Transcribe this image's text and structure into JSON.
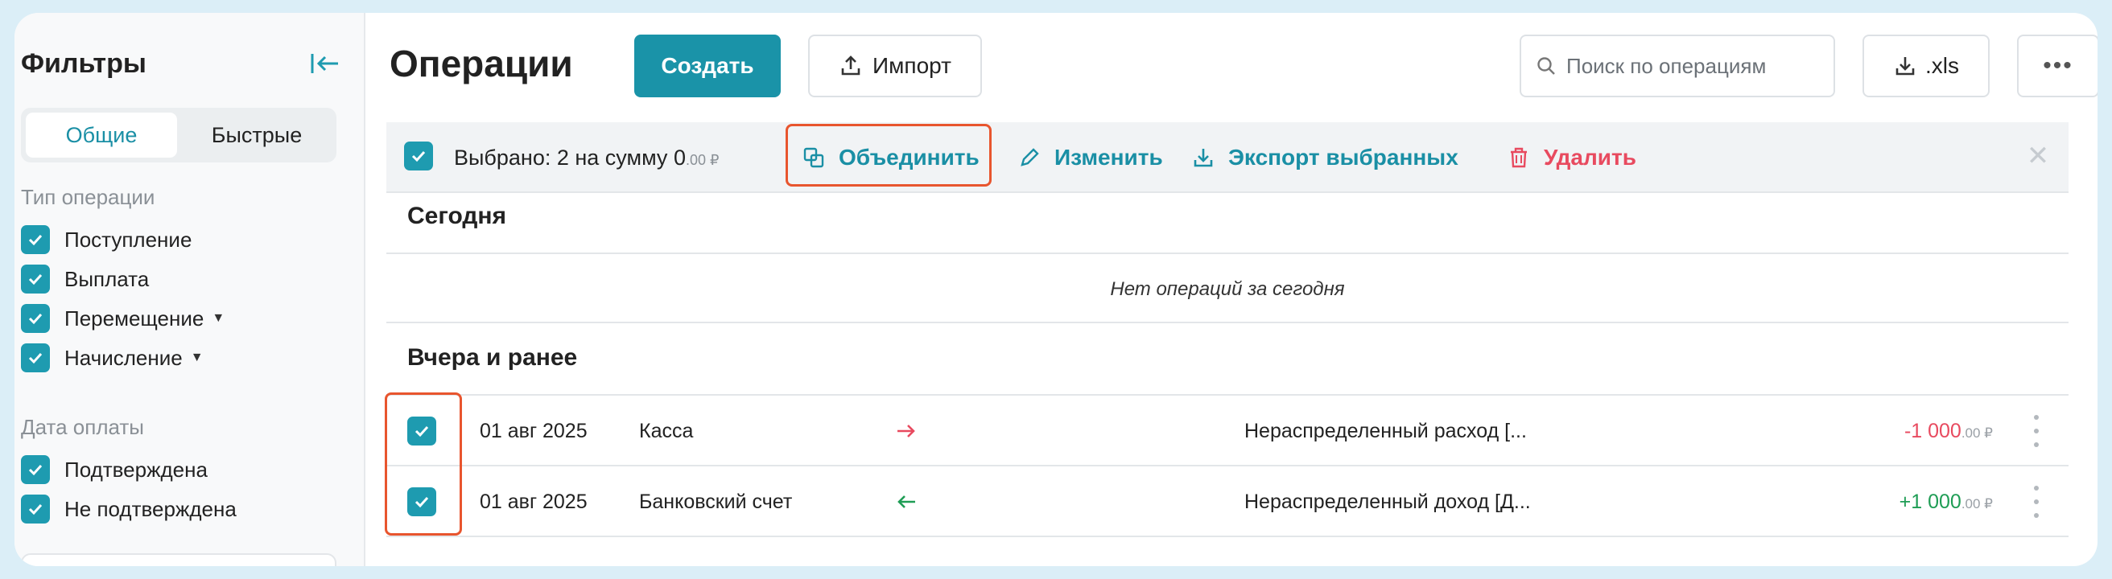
{
  "sidebar": {
    "title": "Фильтры",
    "tabs": [
      {
        "label": "Общие",
        "active": true
      },
      {
        "label": "Быстрые",
        "active": false
      }
    ],
    "operation_type": {
      "label": "Тип операции",
      "items": [
        {
          "label": "Поступление",
          "checked": true,
          "has_dropdown": false
        },
        {
          "label": "Выплата",
          "checked": true,
          "has_dropdown": false
        },
        {
          "label": "Перемещение",
          "checked": true,
          "has_dropdown": true
        },
        {
          "label": "Начисление",
          "checked": true,
          "has_dropdown": true
        }
      ]
    },
    "payment_date": {
      "label": "Дата оплаты",
      "items": [
        {
          "label": "Подтверждена",
          "checked": true
        },
        {
          "label": "Не подтверждена",
          "checked": true
        }
      ]
    }
  },
  "header": {
    "title": "Операции",
    "create_label": "Создать",
    "import_label": "Импорт",
    "search_placeholder": "Поиск по операциям",
    "export_label": ".xls",
    "more_label": "•••"
  },
  "bulk_bar": {
    "selected_text": "Выбрано: 2",
    "sum_label": "на сумму",
    "sum_value": "0",
    "sum_decimals": ".00 ₽",
    "actions": {
      "merge": "Объединить",
      "edit": "Изменить",
      "export": "Экспорт выбранных",
      "delete": "Удалить"
    },
    "close_label": "✕"
  },
  "groups": {
    "today": {
      "title": "Сегодня",
      "empty_text": "Нет операций за сегодня"
    },
    "earlier": {
      "title": "Вчера и ранее"
    }
  },
  "rows": [
    {
      "checked": true,
      "date": "01 авг 2025",
      "account": "Касса",
      "direction": "out",
      "category": "Нераспределенный расход [...",
      "amount": "-1 000",
      "amount_decimals": ".00 ₽",
      "amount_color": "#e84a5f"
    },
    {
      "checked": true,
      "date": "01 авг 2025",
      "account": "Банковский счет",
      "direction": "in",
      "category": "Нераспределенный доход [Д...",
      "amount": "+1 000",
      "amount_decimals": ".00 ₽",
      "amount_color": "#1f9d55"
    }
  ],
  "colors": {
    "accent": "#1a93a8",
    "danger": "#e84a5f",
    "success": "#1f9d55",
    "highlight": "#e8552e"
  }
}
